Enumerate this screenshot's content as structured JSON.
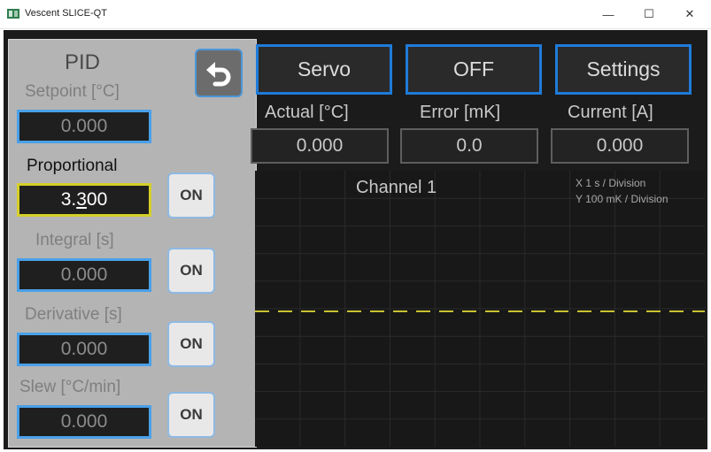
{
  "window": {
    "title": "Vescent SLICE-QT",
    "minimize_glyph": "—",
    "maximize_glyph": "☐",
    "close_glyph": "✕"
  },
  "pid": {
    "heading": "PID",
    "setpoint": {
      "label": "Setpoint [°C]",
      "value": "0.000"
    },
    "proportional": {
      "label": "Proportional",
      "value_before_cursor": "3.",
      "value_cursor_char": "3",
      "value_after_cursor": "00",
      "toggle": "ON"
    },
    "integral": {
      "label": "Integral [s]",
      "value": "0.000",
      "toggle": "ON"
    },
    "derivative": {
      "label": "Derivative [s]",
      "value": "0.000",
      "toggle": "ON"
    },
    "slew": {
      "label": "Slew [°C/min]",
      "value": "0.000",
      "toggle": "ON"
    },
    "back_icon": "undo-arrow-icon"
  },
  "toolbar": {
    "servo_label": "Servo",
    "state_label": "OFF",
    "settings_label": "Settings"
  },
  "readouts": {
    "actual": {
      "label": "Actual [°C]",
      "value": "0.000"
    },
    "error": {
      "label": "Error [mK]",
      "value": "0.0"
    },
    "current": {
      "label": "Current [A]",
      "value": "0.000"
    }
  },
  "chart": {
    "title": "Channel 1",
    "x_scale": "X   1 s / Division",
    "y_scale": "Y   100 mK / Division",
    "trace_color": "#c9c230",
    "trace_value_mK": 0
  },
  "colors": {
    "accent_blue": "#1f7bd9",
    "focus_yellow": "#d4cf2a",
    "panel_gray": "#b4b4b4"
  }
}
